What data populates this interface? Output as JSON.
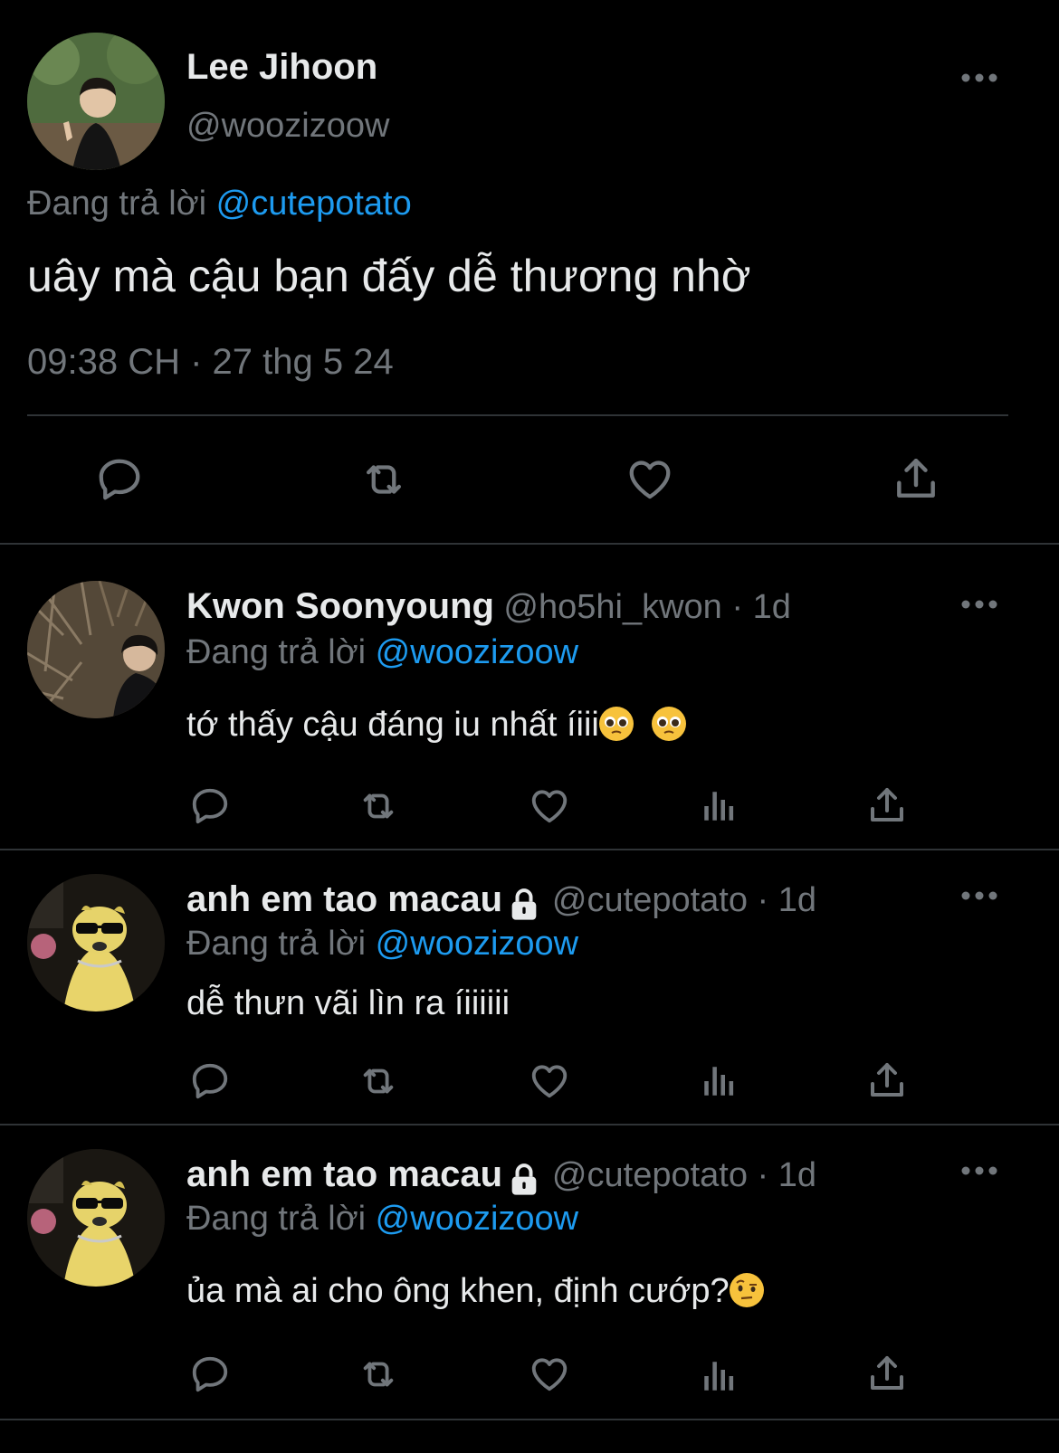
{
  "main_tweet": {
    "name": "Lee Jihoon",
    "handle": "@woozizoow",
    "reply_prefix": "Đang trả lời",
    "reply_to": "@cutepotato",
    "text": "uây mà cậu bạn đấy dễ thương nhờ",
    "timestamp": "09:38 CH · 27 thg 5 24"
  },
  "replies": [
    {
      "name": "Kwon Soonyoung",
      "handle": "@ho5hi_kwon · 1d",
      "reply_prefix": "Đang trả lời",
      "reply_to": "@woozizoow",
      "text": " tớ thấy cậu đáng iu nhất íiii",
      "emojis": [
        "pleading-face",
        "pleading-face"
      ]
    },
    {
      "name": "anh em tao macau",
      "protected": true,
      "handle": "@cutepotato · 1d",
      "reply_prefix": "Đang trả lời",
      "reply_to": "@woozizoow",
      "text": "dễ thưn vãi lìn ra íiiiiii"
    },
    {
      "name": "anh em tao macau",
      "protected": true,
      "handle": "@cutepotato · 1d",
      "reply_prefix": "Đang trả lời",
      "reply_to": "@woozizoow",
      "text": "ủa mà ai cho ông khen, định cướp?",
      "emojis": [
        "face-with-raised-eyebrow"
      ]
    }
  ],
  "icons": {
    "reply": "reply-icon",
    "retweet": "retweet-icon",
    "like": "like-icon",
    "views": "views-icon",
    "share": "share-icon",
    "more": "more-icon",
    "lock": "lock-icon"
  },
  "colors": {
    "background": "#000000",
    "text": "#e7e9ea",
    "secondary": "#71767b",
    "accent": "#1d9bf0",
    "divider": "#2f3336"
  }
}
